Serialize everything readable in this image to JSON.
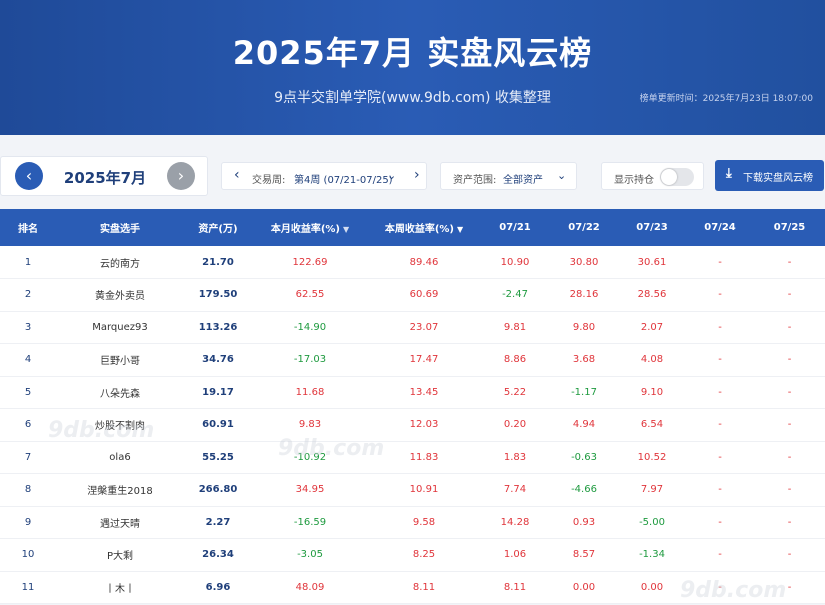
{
  "header": {
    "title": "2025年7月 实盘风云榜",
    "subtitle": "9点半交割单学院(www.9db.com) 收集整理",
    "updated": "榜单更新时间：2025年7月23日 18:07:00"
  },
  "toolbar": {
    "month": "2025年7月",
    "week_label": "交易周:",
    "week_value": "第4周 (07/21-07/25)",
    "asset_label": "资产范围:",
    "asset_value": "全部资产",
    "hold_label": "显示持仓",
    "download_label": "下载实盘风云榜"
  },
  "table": {
    "headers": [
      "排名",
      "实盘选手",
      "资产(万)",
      "本月收益率(%)",
      "本周收益率(%)",
      "07/21",
      "07/22",
      "07/23",
      "07/24",
      "07/25"
    ],
    "rows": [
      [
        "1",
        "云的南方",
        "21.70",
        "122.69",
        "89.46",
        "10.90",
        "30.80",
        "30.61",
        "-",
        "-"
      ],
      [
        "2",
        "黄金外卖员",
        "179.50",
        "62.55",
        "60.69",
        "-2.47",
        "28.16",
        "28.56",
        "-",
        "-"
      ],
      [
        "3",
        "Marquez93",
        "113.26",
        "-14.90",
        "23.07",
        "9.81",
        "9.80",
        "2.07",
        "-",
        "-"
      ],
      [
        "4",
        "巨野小哥",
        "34.76",
        "-17.03",
        "17.47",
        "8.86",
        "3.68",
        "4.08",
        "-",
        "-"
      ],
      [
        "5",
        "八朵先森",
        "19.17",
        "11.68",
        "13.45",
        "5.22",
        "-1.17",
        "9.10",
        "-",
        "-"
      ],
      [
        "6",
        "炒股不割肉",
        "60.91",
        "9.83",
        "12.03",
        "0.20",
        "4.94",
        "6.54",
        "-",
        "-"
      ],
      [
        "7",
        "ola6",
        "55.25",
        "-10.92",
        "11.83",
        "1.83",
        "-0.63",
        "10.52",
        "-",
        "-"
      ],
      [
        "8",
        "涅槃重生2018",
        "266.80",
        "34.95",
        "10.91",
        "7.74",
        "-4.66",
        "7.97",
        "-",
        "-"
      ],
      [
        "9",
        "遇过天晴",
        "2.27",
        "-16.59",
        "9.58",
        "14.28",
        "0.93",
        "-5.00",
        "-",
        "-"
      ],
      [
        "10",
        "P大剩",
        "26.34",
        "-3.05",
        "8.25",
        "1.06",
        "8.57",
        "-1.34",
        "-",
        "-"
      ],
      [
        "11",
        "丨木丨",
        "6.96",
        "48.09",
        "8.11",
        "8.11",
        "0.00",
        "0.00",
        "-",
        "-"
      ]
    ]
  },
  "watermark": "9db.com",
  "icons": {
    "prev": "chevron-left-icon",
    "next": "chevron-right-icon",
    "download": "download-icon",
    "sort": "sort-down-icon"
  },
  "colors": {
    "banner": "#2a5cb5",
    "positive": "#e0353b",
    "negative": "#1e9a3f",
    "accent": "#2a5cb5"
  }
}
